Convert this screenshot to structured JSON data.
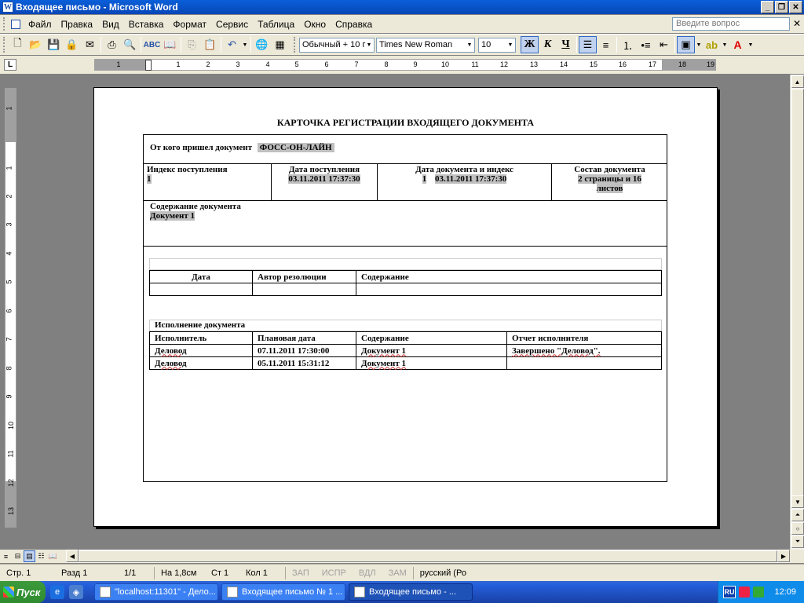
{
  "window": {
    "title": "Входящее письмо - Microsoft Word",
    "app_icon_letter": "W"
  },
  "menu": {
    "items": [
      "Файл",
      "Правка",
      "Вид",
      "Вставка",
      "Формат",
      "Сервис",
      "Таблица",
      "Окно",
      "Справка"
    ],
    "ask_placeholder": "Введите вопрос"
  },
  "toolbar": {
    "style_value": "Обычный + 10 г",
    "font_value": "Times New Roman",
    "size_value": "10",
    "bold_label": "Ж",
    "italic_label": "К",
    "underline_label": "Ч"
  },
  "ruler": {
    "tab_selector": "L",
    "h_numbers": [
      "1",
      "1",
      "2",
      "3",
      "4",
      "5",
      "6",
      "7",
      "8",
      "9",
      "10",
      "11",
      "12",
      "13",
      "14",
      "15",
      "16",
      "17",
      "18",
      "19"
    ],
    "v_numbers": [
      "1",
      "1",
      "2",
      "3",
      "4",
      "5",
      "6",
      "7",
      "8",
      "9",
      "10",
      "11",
      "12",
      "13"
    ]
  },
  "document": {
    "title": "КАРТОЧКА РЕГИСТРАЦИИ ВХОДЯЩЕГО ДОКУМЕНТА",
    "from_label": "От кого пришел документ",
    "from_value": "ФОСС-ОН-ЛАЙН",
    "index_label": "Индекс поступления",
    "index_value": "1",
    "arrival_label": "Дата поступления",
    "arrival_value": "03.11.2011 17:37:30",
    "docdate_label": "Дата документа и индекс",
    "docdate_index": "1",
    "docdate_value": "03.11.2011 17:37:30",
    "composition_label": "Состав документа",
    "composition_value_1": "2 страницы и 16",
    "composition_value_2": "листов",
    "content_label": "Содержание документа",
    "content_value": "Документ 1",
    "resolutions": {
      "headers": [
        "Дата",
        "Автор резолюции",
        "Содержание"
      ]
    },
    "execution": {
      "title": "Исполнение документа",
      "headers": [
        "Исполнитель",
        "Плановая дата",
        "Содержание",
        "Отчет исполнителя"
      ],
      "rows": [
        [
          "Деловод",
          "07.11.2011 17:30:00",
          "Документ 1",
          "Завершено \"Деловод\"."
        ],
        [
          "Деловод",
          "05.11.2011 15:31:12",
          "Документ 1",
          ""
        ]
      ]
    }
  },
  "status": {
    "page": "Стр. 1",
    "section": "Разд 1",
    "pages": "1/1",
    "at": "На 1,8см",
    "line": "Ст 1",
    "col": "Кол 1",
    "rec": "ЗАП",
    "trk": "ИСПР",
    "ext": "ВДЛ",
    "ovr": "ЗАМ",
    "language": "русский (Ро"
  },
  "taskbar": {
    "start_label": "Пуск",
    "tasks": [
      "\"localhost:11301\" - Дело...",
      "Входящее письмо № 1 ...",
      "Входящее письмо - ..."
    ],
    "lang": "RU",
    "clock": "12:09"
  },
  "colors": {
    "titlebar": "#0a5fd8",
    "highlight": "#c0c0c0",
    "workspace": "#808080"
  }
}
